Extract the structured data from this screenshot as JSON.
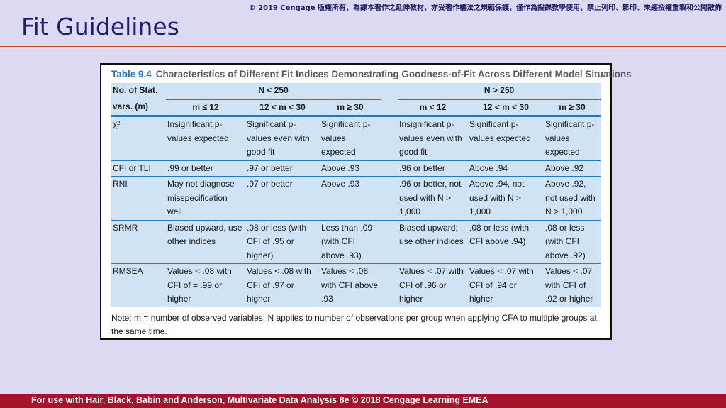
{
  "copyright_notice": "© 2019 Cengage 版權所有，為課本著作之延伸教材，亦受著作權法之規範保護，僅作為授課教學使用，禁止列印、影印、未經授權重製和公開散佈",
  "slide_title": "Fit Guidelines",
  "table": {
    "number": "Table 9.4",
    "caption": "Characteristics of Different Fit Indices Demonstrating Goodness-of-Fit Across Different Model Situations",
    "row_header_line1": "No. of Stat.",
    "row_header_line2": "vars. (m)",
    "group_small": "N < 250",
    "group_large": "N > 250",
    "sub_small": [
      "m ≤ 12",
      "12 < m < 30",
      "m ≥ 30"
    ],
    "sub_large": [
      "m < 12",
      "12 < m < 30",
      "m ≥ 30"
    ],
    "rows": [
      {
        "label": "χ²",
        "cells": [
          "Insignificant p-values expected",
          "Significant p-values even with good fit",
          "Significant p-values expected",
          "Insignificant p-values even with good fit",
          "Significant p-values expected",
          "Significant p-values expected"
        ]
      },
      {
        "label": "CFI or TLI",
        "cells": [
          ".99 or better",
          ".97 or better",
          "Above .93",
          ".96 or better",
          "Above .94",
          "Above .92"
        ]
      },
      {
        "label": "RNI",
        "cells": [
          "May not diagnose misspecification well",
          ".97 or better",
          "Above .93",
          ".96 or better, not used with N > 1,000",
          "Above .94, not used with N > 1,000",
          "Above .92, not used with N > 1,000"
        ]
      },
      {
        "label": "SRMR",
        "cells": [
          "Biased upward, use other indices",
          ".08 or less (with CFI of .95 or higher)",
          "Less than .09 (with CFI above .93)",
          "Biased upward; use other indices",
          ".08 or less (with CFI above .94)",
          ".08 or less (with CFI above .92)"
        ]
      },
      {
        "label": "RMSEA",
        "cells": [
          "Values < .08  with CFI of = .99 or higher",
          "Values < .08 with CFI of .97 or higher",
          "Values < .08 with CFI above .93",
          "Values < .07 with CFI of .96 or higher",
          "Values < .07 with CFI of .94 or higher",
          "Values < .07 with CFI of .92 or higher"
        ]
      }
    ],
    "note": "Note: m = number of observed variables; N applies to number of observations per group when applying CFA to multiple groups at the same time."
  },
  "footer_text": "For use with Hair, Black, Babin and Anderson, Multivariate Data Analysis 8e © 2018 Cengage Learning EMEA"
}
